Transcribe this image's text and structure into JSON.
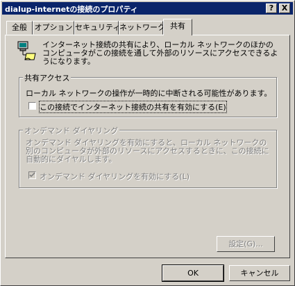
{
  "window": {
    "title": "dialup-internetの接続のプロパティ"
  },
  "titlebar_buttons": {
    "help": "?",
    "close": "X"
  },
  "tabs": [
    {
      "label": "全般"
    },
    {
      "label": "オプション"
    },
    {
      "label": "セキュリティ"
    },
    {
      "label": "ネットワーク"
    },
    {
      "label": "共有"
    }
  ],
  "active_tab": "共有",
  "intro_text": "インターネット接続の共有により、ローカル ネットワークのほかのコンピュータがこの接続を通して外部のリソースにアクセスできるようになります。",
  "sharing": {
    "group_title": "共有アクセス",
    "warning": "ローカル ネットワークの操作が一時的に中断される可能性があります。",
    "checkbox_label": "この接続でインターネット接続の共有を有効にする(E)",
    "checked": false
  },
  "on_demand": {
    "group_title": "オンデマンド ダイヤリング",
    "description": "オンデマンド ダイヤリングを有効にすると、ローカル ネットワークの別のコンピュータが外部のリソースにアクセスするときに、この接続に自動的にダイヤルします。",
    "checkbox_label": "オンデマンド ダイヤリングを有効にする(L)",
    "checked": true,
    "enabled": false
  },
  "buttons": {
    "settings": "設定(G)...",
    "ok": "OK",
    "cancel": "キャンセル"
  },
  "icons": {
    "network": "network-computers-icon"
  }
}
